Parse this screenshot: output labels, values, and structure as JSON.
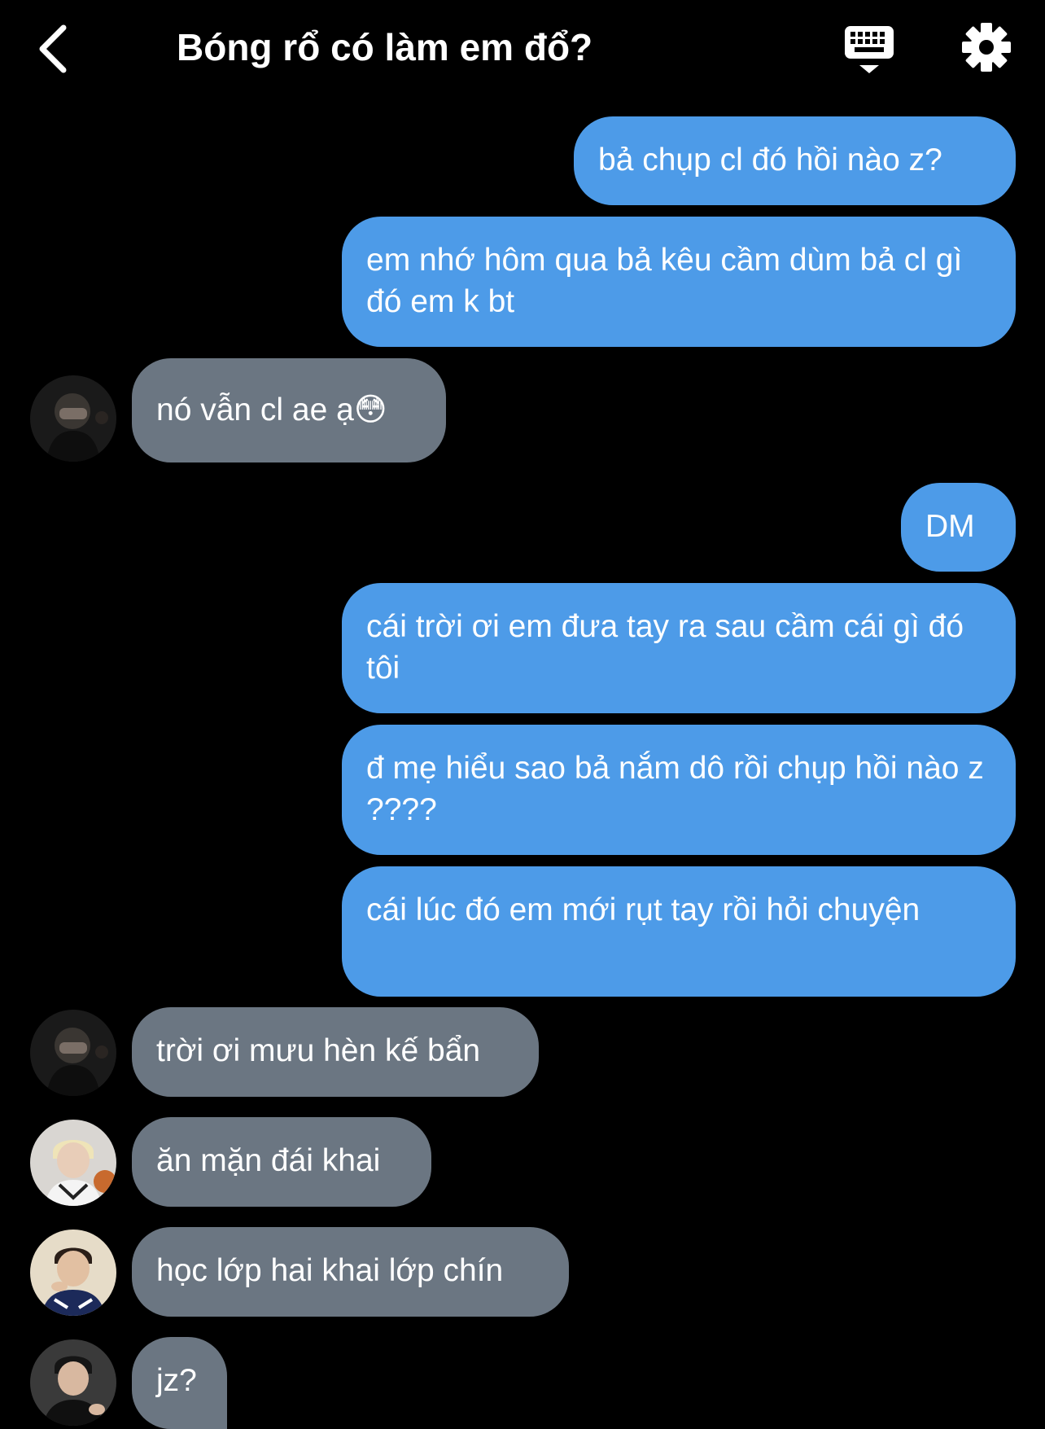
{
  "header": {
    "title": "Bóng rổ có làm em đổ?",
    "back_icon": "chevron-left-icon",
    "keyboard_icon": "keyboard-icon",
    "settings_icon": "gear-icon"
  },
  "colors": {
    "background": "#000000",
    "outgoing_bubble": "#4d9be8",
    "incoming_bubble": "#6b7682",
    "text": "#ffffff"
  },
  "messages": [
    {
      "direction": "outgoing",
      "text": "bả chụp cl đó hồi nào z?"
    },
    {
      "direction": "outgoing",
      "text": "em nhớ hôm qua bả kêu cầm dùm bả cl gì đó em k bt"
    },
    {
      "direction": "incoming",
      "sender_avatar": "avatar-1",
      "text": "nó vẫn cl ae ạ😳"
    },
    {
      "direction": "outgoing",
      "text": "DM"
    },
    {
      "direction": "outgoing",
      "text": "cái trời ơi em đưa tay ra sau cầm cái gì đó tôi"
    },
    {
      "direction": "outgoing",
      "text": "đ mẹ hiểu sao bả nắm dô rồi chụp hồi nào z ????"
    },
    {
      "direction": "outgoing",
      "text": "cái lúc đó em mới rụt tay rồi hỏi chuyện"
    },
    {
      "direction": "incoming",
      "sender_avatar": "avatar-1",
      "text": "trời ơi mưu hèn kế bẩn"
    },
    {
      "direction": "incoming",
      "sender_avatar": "avatar-2",
      "text": "ăn mặn đái khai"
    },
    {
      "direction": "incoming",
      "sender_avatar": "avatar-3",
      "text": "học lớp hai khai lớp chín"
    },
    {
      "direction": "incoming",
      "sender_avatar": "avatar-4",
      "text": "jz?"
    }
  ]
}
